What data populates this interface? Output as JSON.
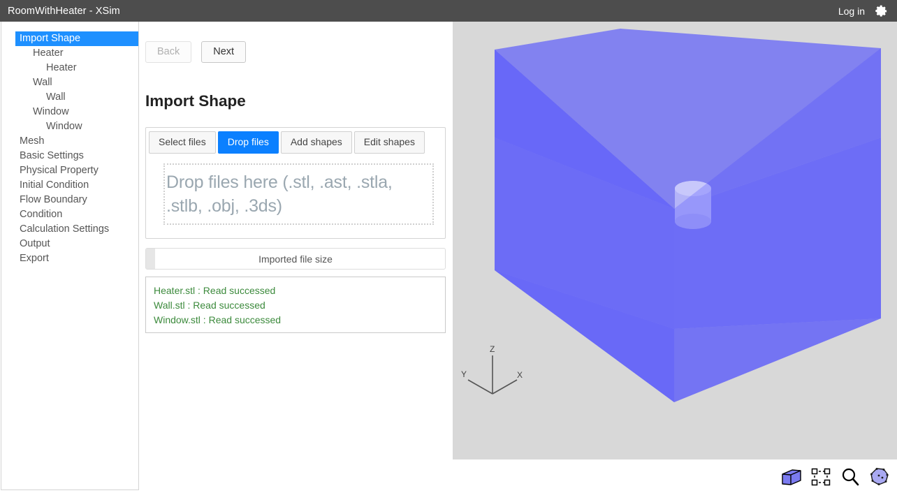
{
  "titlebar": {
    "title": "RoomWithHeater - XSim",
    "login_label": "Log in",
    "gear_icon": "gear-icon"
  },
  "sidebar": {
    "items": [
      {
        "label": "Import Shape",
        "level": 0,
        "selected": true
      },
      {
        "label": "Heater",
        "level": 1,
        "selected": false
      },
      {
        "label": "Heater",
        "level": 2,
        "selected": false
      },
      {
        "label": "Wall",
        "level": 1,
        "selected": false
      },
      {
        "label": "Wall",
        "level": 2,
        "selected": false
      },
      {
        "label": "Window",
        "level": 1,
        "selected": false
      },
      {
        "label": "Window",
        "level": 2,
        "selected": false
      },
      {
        "label": "Mesh",
        "level": 0,
        "selected": false
      },
      {
        "label": "Basic Settings",
        "level": 0,
        "selected": false
      },
      {
        "label": "Physical Property",
        "level": 0,
        "selected": false
      },
      {
        "label": "Initial Condition",
        "level": 0,
        "selected": false
      },
      {
        "label": "Flow Boundary",
        "level": 0,
        "selected": false
      },
      {
        "label": "Condition",
        "level": 0,
        "selected": false
      },
      {
        "label": "Calculation Settings",
        "level": 0,
        "selected": false
      },
      {
        "label": "Output",
        "level": 0,
        "selected": false
      },
      {
        "label": "Export",
        "level": 0,
        "selected": false
      }
    ]
  },
  "main": {
    "back_label": "Back",
    "next_label": "Next",
    "page_title": "Import Shape",
    "tabs": [
      {
        "label": "Select files",
        "active": false
      },
      {
        "label": "Drop files",
        "active": true
      },
      {
        "label": "Add shapes",
        "active": false
      },
      {
        "label": "Edit shapes",
        "active": false
      }
    ],
    "dropzone_text": "Drop files here (.stl, .ast, .stla, .stlb, .obj, .3ds)",
    "progress": {
      "label": "Imported file size",
      "percent": 3
    },
    "log_lines": [
      "Heater.stl : Read successed",
      "Wall.stl : Read successed",
      "Window.stl : Read successed"
    ]
  },
  "viewport": {
    "axis": {
      "x": "X",
      "y": "Y",
      "z": "Z"
    },
    "background_color": "#d8d8d8",
    "shape_color": "#4d4dff",
    "heater_color": "#b0b0f5"
  },
  "toolbar": {
    "tools": [
      {
        "name": "box-view-icon"
      },
      {
        "name": "select-box-icon"
      },
      {
        "name": "zoom-icon"
      },
      {
        "name": "mesh-polygon-icon"
      }
    ]
  },
  "colors": {
    "accent": "#0b80ff",
    "titlebar": "#4d4d4d",
    "selection": "#1e90ff",
    "log_text": "#3c8a3c"
  }
}
